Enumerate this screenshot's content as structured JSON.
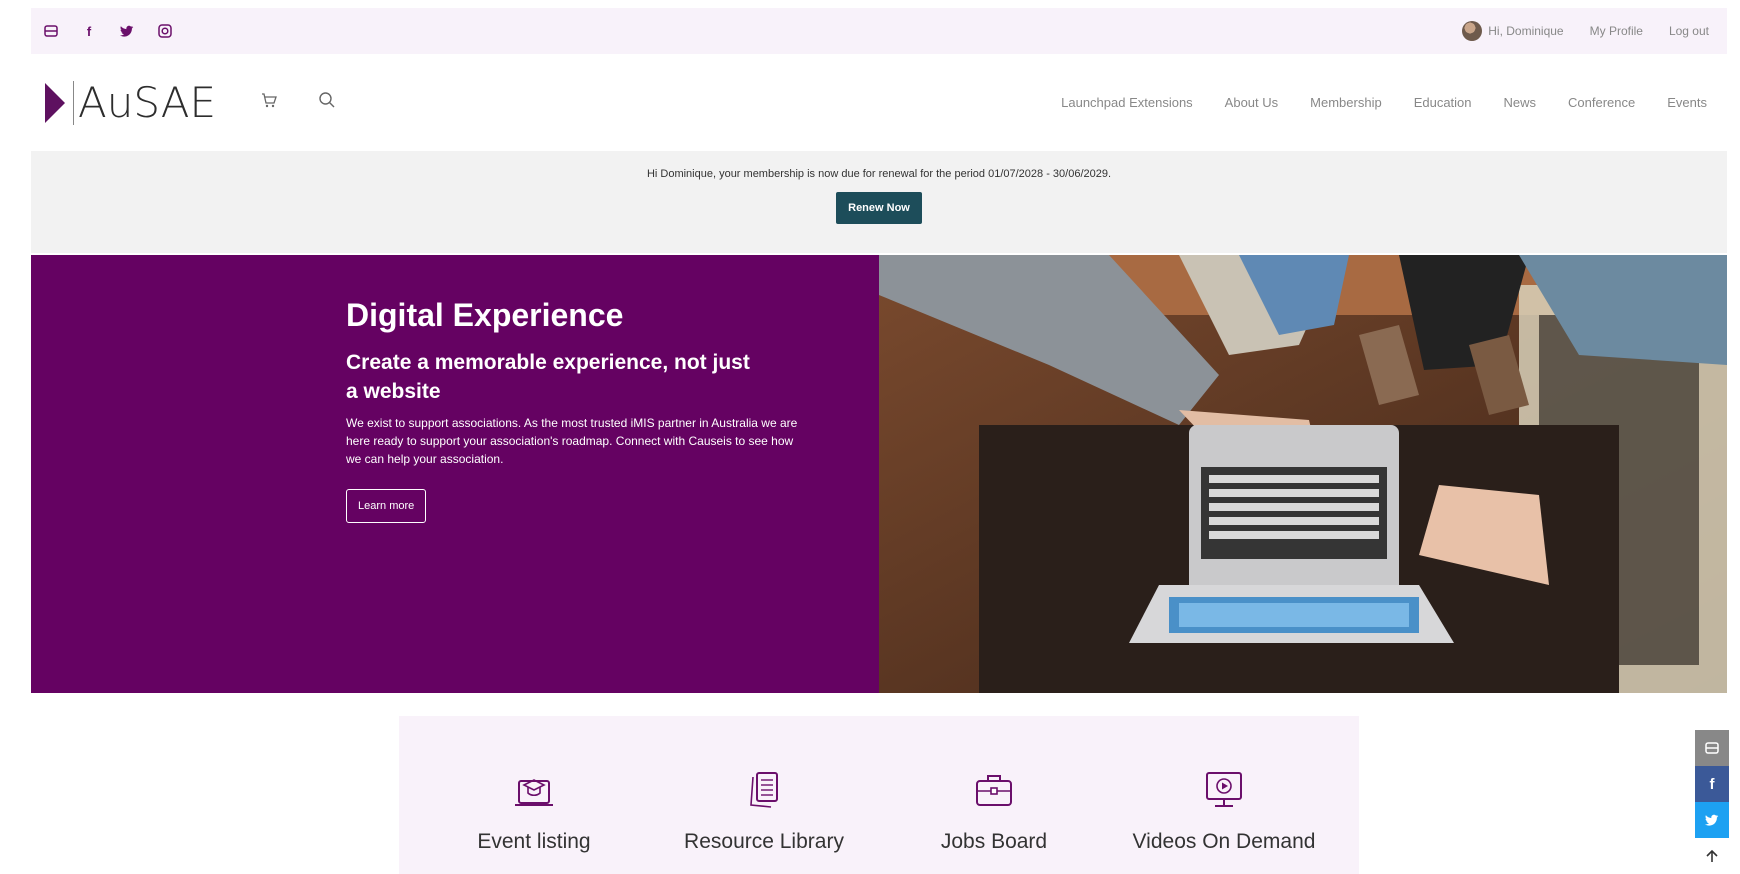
{
  "topbar": {
    "social_icons": [
      "email-icon",
      "facebook-icon",
      "twitter-icon",
      "instagram-icon"
    ],
    "greeting": "Hi, Dominique",
    "profile_link": "My Profile",
    "logout_link": "Log out"
  },
  "header": {
    "logo_text": "AuSAE",
    "nav": [
      "Launchpad Extensions",
      "About Us",
      "Membership",
      "Education",
      "News",
      "Conference",
      "Events"
    ]
  },
  "renewal": {
    "message": "Hi Dominique, your membership is now due for renewal for the period 01/07/2028 - 30/06/2029.",
    "button_label": "Renew Now"
  },
  "hero": {
    "title": "Digital Experience",
    "subtitle": "Create a memorable experience, not just a website",
    "body": "We exist to support associations. As the most trusted iMIS partner in Australia we are here ready to support your association's roadmap. Connect with Causeis to see how we can help your association.",
    "button_label": "Learn more"
  },
  "features": [
    {
      "label": "Event listing",
      "icon": "graduation-laptop-icon"
    },
    {
      "label": "Resource Library",
      "icon": "documents-icon"
    },
    {
      "label": "Jobs Board",
      "icon": "briefcase-icon"
    },
    {
      "label": "Videos On Demand",
      "icon": "video-monitor-icon"
    }
  ],
  "colors": {
    "brand_purple": "#650262",
    "renew_button": "#1d4d5a",
    "topbar_bg": "#f8f2fa",
    "renewal_bg": "#f2f2f2"
  }
}
